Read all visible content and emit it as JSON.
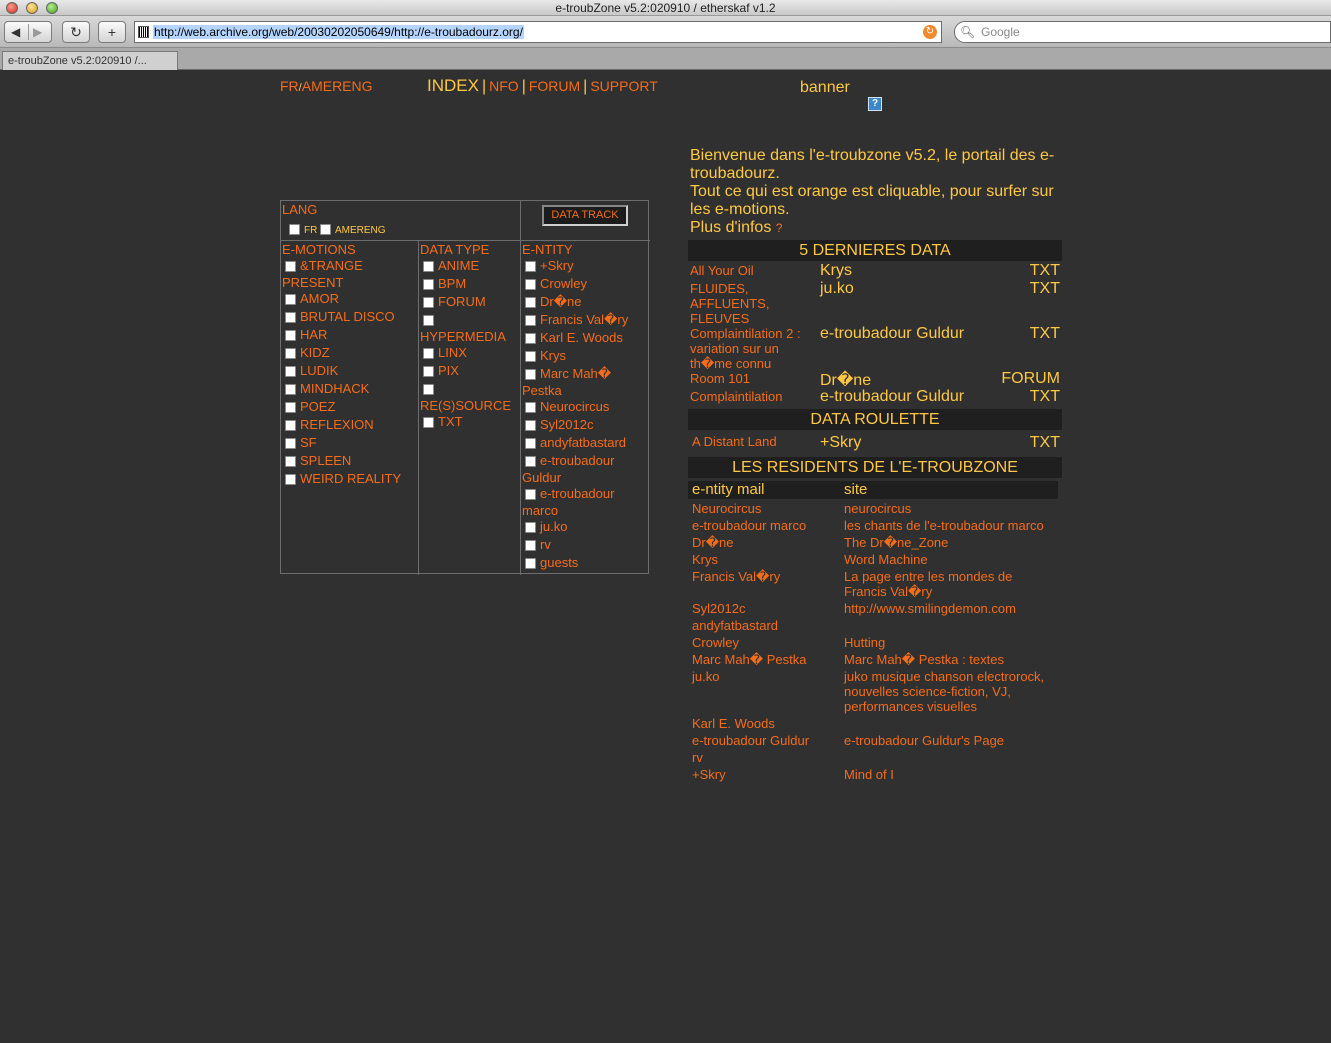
{
  "browser": {
    "window_title": "e-troubZone v5.2:020910 / etherskaf v1.2",
    "url_selected": "http://web.archive.org/web/20030202050649/http://e-troubadourz.org/",
    "search_placeholder": "Google",
    "tab_label": "e-troubZone v5.2:020910 /..."
  },
  "topnav": {
    "lang_fr": "FR",
    "lang_slash": "/",
    "lang_ameng": "AMERENG",
    "index": "INDEX",
    "sep": "|",
    "nfo": "NFO",
    "forum": "FORUM",
    "support": "SUPPORT",
    "banner": "banner",
    "banner_help_icon": "?"
  },
  "filters": {
    "lang_label": "LANG",
    "lang_fr": "FR",
    "lang_ameng": "AMERENG",
    "data_track_button": "DATA TRACK",
    "emotions_label": "E-MOTIONS",
    "emotions": [
      "&TRANGE",
      "PRESENT",
      "AMOR",
      "BRUTAL DISCO",
      "HAR",
      "KIDZ",
      "LUDIK",
      "MINDHACK",
      "POEZ",
      "REFLEXION",
      "SF",
      "SPLEEN",
      "WEIRD REALITY"
    ],
    "datatype_label": "DATA TYPE",
    "datatype": [
      "ANIME",
      "BPM",
      "FORUM",
      "HYPERMEDIA",
      "LINX",
      "PIX",
      "RE(S)SOURCE",
      "TXT"
    ],
    "entity_label": "E-NTITY",
    "entity": [
      "+Skry",
      "Crowley",
      "Dr�ne",
      "Francis Val�ry",
      "Karl E. Woods",
      "Krys",
      "Marc Mah�",
      "Pestka",
      "Neurocircus",
      "Syl2012c",
      "andyfatbastard",
      "e-troubadour",
      "Guldur",
      "e-troubadour",
      "marco",
      "ju.ko",
      "rv",
      "guests"
    ]
  },
  "welcome": {
    "line1": "Bienvenue dans l'e-troubzone v5.2, le portail des e-troubadourz.",
    "line2": "Tout ce qui est orange est cliquable, pour surfer sur les e-motions.",
    "line3": "Plus d'infos",
    "help": "?"
  },
  "last_data": {
    "title": "5 DERNIERES DATA",
    "rows": [
      {
        "title": "All Your Oil",
        "author": "Krys",
        "type": "TXT"
      },
      {
        "title": "FLUIDES, AFFLUENTS, FLEUVES",
        "author": "ju.ko",
        "type": "TXT"
      },
      {
        "title": "Complaintilation 2 : variation sur un th�me connu",
        "author": "e-troubadour Guldur",
        "type": "TXT"
      },
      {
        "title": "Room 101",
        "author": "Dr�ne",
        "type": "FORUM"
      },
      {
        "title": "Complaintilation",
        "author": "e-troubadour Guldur",
        "type": "TXT"
      }
    ]
  },
  "roulette": {
    "title": "DATA ROULETTE",
    "row": {
      "title": "A Distant Land",
      "author": "+Skry",
      "type": "TXT"
    }
  },
  "residents": {
    "title": "LES RESIDENTS DE L'E-TROUBZONE",
    "col_entity": "e-ntity mail",
    "col_site": "site",
    "rows": [
      {
        "name": "Neurocircus",
        "site": "neurocircus"
      },
      {
        "name": "e-troubadour marco",
        "site": "les chants de l'e-troubadour marco"
      },
      {
        "name": "Dr�ne",
        "site": "The Dr�ne_Zone"
      },
      {
        "name": "Krys",
        "site": "Word Machine"
      },
      {
        "name": "Francis Val�ry",
        "site": "La page entre les mondes de Francis Val�ry"
      },
      {
        "name": "Syl2012c",
        "site": "http://www.smilingdemon.com"
      },
      {
        "name": "andyfatbastard",
        "site": ""
      },
      {
        "name": "Crowley",
        "site": "Hutting"
      },
      {
        "name": "Marc Mah� Pestka",
        "site": "Marc Mah� Pestka : textes"
      },
      {
        "name": "ju.ko",
        "site": "juko musique chanson electrorock, nouvelles science-fiction, VJ, performances visuelles"
      },
      {
        "name": "Karl E. Woods",
        "site": ""
      },
      {
        "name": "e-troubadour Guldur",
        "site": "e-troubadour Guldur's Page"
      },
      {
        "name": "rv",
        "site": ""
      },
      {
        "name": "+Skry",
        "site": "Mind of I"
      }
    ]
  }
}
